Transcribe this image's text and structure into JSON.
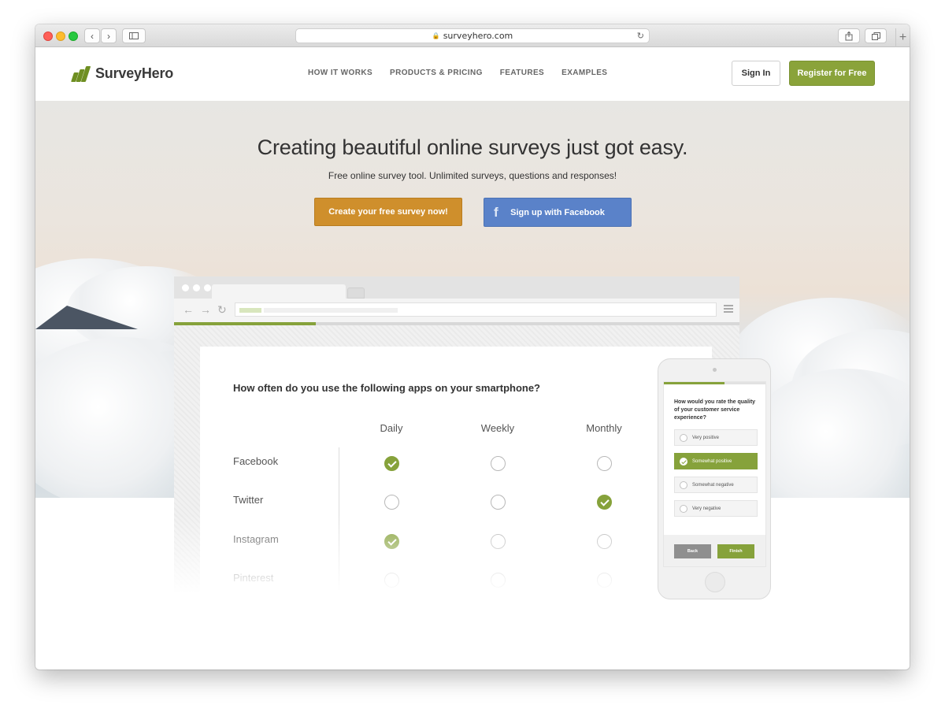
{
  "browser": {
    "url": "surveyhero.com"
  },
  "header": {
    "logo_text": "SurveyHero",
    "nav": [
      "HOW IT WORKS",
      "PRODUCTS & PRICING",
      "FEATURES",
      "EXAMPLES"
    ],
    "sign_in": "Sign In",
    "register": "Register for Free"
  },
  "hero": {
    "title": "Creating beautiful online surveys just got easy.",
    "subtitle": "Free online survey tool. Unlimited surveys, questions and responses!",
    "cta_primary": "Create your free survey now!",
    "cta_facebook": "Sign up with Facebook",
    "facebook_glyph": "f"
  },
  "survey": {
    "question": "How often do you use the following apps on your smartphone?",
    "columns": [
      "Daily",
      "Weekly",
      "Monthly"
    ],
    "rows": [
      {
        "label": "Facebook",
        "selected": "Daily"
      },
      {
        "label": "Twitter",
        "selected": "Monthly"
      },
      {
        "label": "Instagram",
        "selected": "Daily"
      },
      {
        "label": "Pinterest",
        "selected": ""
      }
    ],
    "progress": 0.25
  },
  "phone": {
    "question": "How would you rate the quality of your customer service experience?",
    "options": [
      {
        "label": "Very positive",
        "selected": false
      },
      {
        "label": "Somewhat positive",
        "selected": true
      },
      {
        "label": "Somewhat negative",
        "selected": false
      },
      {
        "label": "Very negative",
        "selected": false
      }
    ],
    "back": "Back",
    "finish": "Finish",
    "progress": 0.6
  },
  "colors": {
    "brand_green": "#86a23b",
    "cta_orange": "#cf8f2c",
    "facebook_blue": "#5a82c9"
  },
  "icons": [
    "lock-icon",
    "reload-icon",
    "back-arrow-icon",
    "forward-arrow-icon",
    "sidebar-icon",
    "share-icon",
    "tabs-icon",
    "plus-icon",
    "facebook-icon",
    "checkmark-icon"
  ]
}
